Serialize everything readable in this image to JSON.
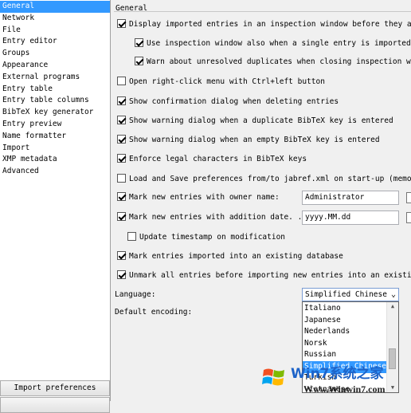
{
  "sidebar": {
    "items": [
      {
        "label": "General",
        "selected": true
      },
      {
        "label": "Network"
      },
      {
        "label": "File"
      },
      {
        "label": "Entry editor"
      },
      {
        "label": "Groups"
      },
      {
        "label": "Appearance"
      },
      {
        "label": "External programs"
      },
      {
        "label": "Entry table"
      },
      {
        "label": "Entry table columns"
      },
      {
        "label": "BibTeX key generator"
      },
      {
        "label": "Entry preview"
      },
      {
        "label": "Name formatter"
      },
      {
        "label": "Import"
      },
      {
        "label": "XMP metadata"
      },
      {
        "label": "Advanced"
      }
    ],
    "import_button": "Import preferences"
  },
  "main": {
    "section_title": "General",
    "options": {
      "display_imported": {
        "label": "Display imported entries in an inspection window before they are adde",
        "checked": true
      },
      "use_inspection_single": {
        "label": "Use inspection window also when a single entry is imported.",
        "checked": true
      },
      "warn_unresolved": {
        "label": "Warn about unresolved duplicates when closing inspection window",
        "checked": true
      },
      "open_right_click": {
        "label": "Open right-click menu with Ctrl+left button",
        "checked": false
      },
      "confirm_delete": {
        "label": "Show confirmation dialog when deleting entries",
        "checked": true
      },
      "warn_duplicate_key": {
        "label": "Show warning dialog when a duplicate BibTeX key is entered",
        "checked": true
      },
      "warn_empty_key": {
        "label": "Show warning dialog when an empty BibTeX key is entered",
        "checked": true
      },
      "enforce_legal": {
        "label": "Enforce legal characters in BibTeX keys",
        "checked": true
      },
      "load_save_prefs": {
        "label": "Load and Save preferences from/to jabref.xml on start-up (memory stic",
        "checked": false
      },
      "mark_owner": {
        "label": "Mark new entries with owner name:",
        "checked": true,
        "value": "Administrator"
      },
      "mark_date": {
        "label": "Mark new entries with addition date. ...",
        "checked": true,
        "value": "yyyy.MM.dd"
      },
      "update_timestamp": {
        "label": "Update timestamp on modification",
        "checked": false
      },
      "mark_imported": {
        "label": "Mark entries imported into an existing database",
        "checked": true
      },
      "unmark_all": {
        "label": "Unmark all entries before importing new entries into an existing data",
        "checked": true
      }
    },
    "language": {
      "label": "Language:",
      "selected": "Simplified Chinese",
      "options": [
        "Italiano",
        "Japanese",
        "Nederlands",
        "Norsk",
        "Russian",
        "Simplified Chinese",
        "Turkish",
        "Vietnamese"
      ]
    },
    "default_encoding": {
      "label": "Default encoding:"
    }
  },
  "watermark": {
    "line1": "Win7系统之家",
    "line2": "Www.Winwin7.com",
    "accent": "#1d63c8"
  }
}
